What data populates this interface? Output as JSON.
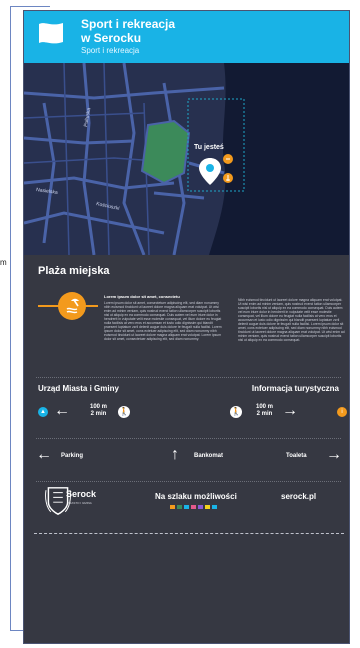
{
  "header": {
    "title_line1": "Sport i rekreacja",
    "title_line2": "w Serocku",
    "subtitle": "Sport i rekreacja"
  },
  "map": {
    "you_are_here": "Tu jesteś",
    "street_labels": [
      "Pułtuska",
      "Nasielska",
      "Kościuszki"
    ]
  },
  "section": {
    "title": "Plaża miejska",
    "lead": "Lorem ipsum dolor sit amet, consectetu",
    "col1": "Lorem ipsum dolor sit amet, consectetuer adipiscing elit, sed diam nonummy nibh euismod tincidunt ut laoreet dolore magna aliquam erat volutpat. Ut wisi enim ad minim veniam, quis nostrud exerci tation ullamcorper suscipit lobortis nisl ut aliquip ex ea commodo consequat. Duis autem vel eum iriure dolor in hendrerit in vulputate velit esse molestie consequat, vel illum dolore eu feugiat nulla facilisis at vero eros et accumsan et iusto odio dignissim qui blandit praesent luptatum zzril delenit augue duis dolore te feugait nulla facilisi. Lorem ipsum dolor sit amet, cons ectetuer adipiscing elit, sed diam nonummy nibh euismod tincidunt ut laoreet dolore magna aliquam erat volutpat. Lorem ipsum dolor sit amet, consectetuer adipiscing elit, sed diam nonummy.",
    "col2": "Nibh euismod tincidunt ut laoreet dolore magna aliquam erat volutpat. Ut wisi enim ad minim veniam, quis nostrud exerci tation ullamcorper suscipit lobortis nisl ut aliquip ex ea commodo consequat. Duis autem vel eum iriure dolor in hendrerit in vulputate velit esse molestie consequat, vel illum dolore eu feugiat nulla facilisis at vero eros et accumsan et iusto odio dignissim qui blandit praesent luptatum zzril delenit augue duis dolore te feugait nulla facilisi. Lorem ipsum dolor sit amet, cons ectetuer adipiscing elit, sed diam nonummy nibh euismod tincidunt ut laoreet dolore magna aliquam erat volutpat. Ut wisi enim ad minim veniam, quis nostrud exerci tation ullamcorper suscipit lobortis nisl ut aliquip ex ea commodo consequat."
  },
  "directions": {
    "left": {
      "title": "Urząd Miasta i Gminy",
      "distance_m": "100 m",
      "distance_min": "2 min"
    },
    "right": {
      "title": "Informacja turystyczna",
      "distance_m": "100 m",
      "distance_min": "2 min"
    }
  },
  "row": {
    "parking": "Parking",
    "atm": "Bankomat",
    "toilet": "Toaleta"
  },
  "footer": {
    "logo_name": "Serock",
    "logo_sub": "MIASTO I GMINA",
    "trail": "Na szlaku możliwości",
    "website": "serock.pl"
  },
  "page": {
    "dimension_label": "m"
  },
  "colors": {
    "header": "#19b3e6",
    "panel": "#363842",
    "accent_orange": "#f39a1d",
    "park_green": "#3c8a5a",
    "map_bg": "#1f2540"
  }
}
